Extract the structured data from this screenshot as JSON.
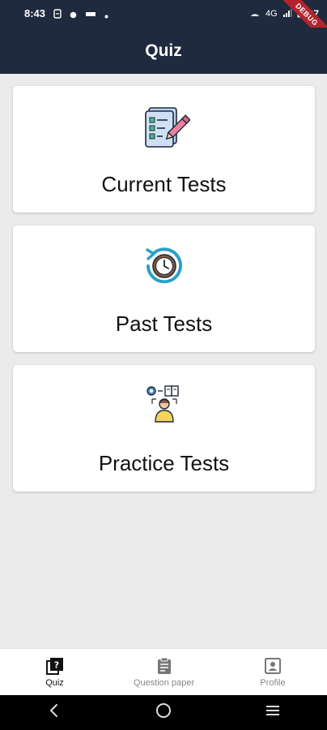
{
  "status_bar": {
    "time": "8:43",
    "network": "4G",
    "battery": "87"
  },
  "debug_banner": "DEBUG",
  "app_bar": {
    "title": "Quiz"
  },
  "cards": [
    {
      "label": "Current Tests",
      "icon": "checklist-pencil-icon"
    },
    {
      "label": "Past Tests",
      "icon": "history-clock-icon"
    },
    {
      "label": "Practice Tests",
      "icon": "practice-person-icon"
    }
  ],
  "bottom_nav": {
    "items": [
      {
        "label": "Quiz",
        "icon": "quiz-icon",
        "active": true
      },
      {
        "label": "Question paper",
        "icon": "clipboard-icon",
        "active": false
      },
      {
        "label": "Profile",
        "icon": "profile-card-icon",
        "active": false
      }
    ]
  },
  "colors": {
    "app_bar": "#1f2a3e",
    "background": "#ebebeb",
    "card": "#ffffff",
    "debug_banner": "#b4232b"
  }
}
